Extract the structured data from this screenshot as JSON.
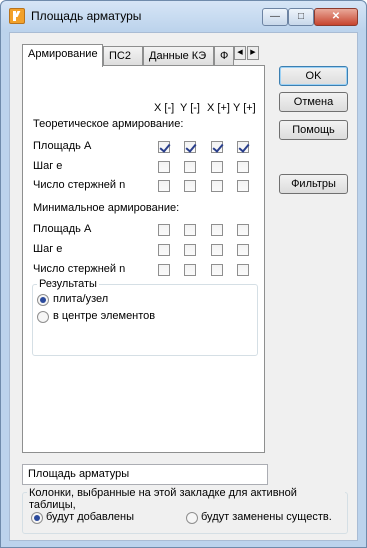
{
  "window": {
    "title": "Площадь арматуры"
  },
  "tabs": [
    "Армирование",
    "ПС2",
    "Данные КЭ",
    "Ф"
  ],
  "columns": [
    "X [-]",
    "Y [-]",
    "X [+]",
    "Y [+]"
  ],
  "theoretical": {
    "section_title": "Теоретическое армирование:",
    "rows": [
      {
        "label": "Площадь A",
        "checked": [
          true,
          true,
          true,
          true
        ]
      },
      {
        "label": "Шаг e",
        "checked": [
          false,
          false,
          false,
          false
        ]
      },
      {
        "label": "Число стержней n",
        "checked": [
          false,
          false,
          false,
          false
        ]
      }
    ]
  },
  "minimal": {
    "section_title": "Минимальное армирование:",
    "rows": [
      {
        "label": "Площадь A",
        "checked": [
          false,
          false,
          false,
          false
        ]
      },
      {
        "label": "Шаг e",
        "checked": [
          false,
          false,
          false,
          false
        ]
      },
      {
        "label": "Число стержней n",
        "checked": [
          false,
          false,
          false,
          false
        ]
      }
    ]
  },
  "results": {
    "title": "Результаты",
    "options": [
      "плита/узел",
      "в центре элементов"
    ],
    "selected": 0
  },
  "buttons": {
    "ok": "OK",
    "cancel": "Отмена",
    "help": "Помощь",
    "filters": "Фильтры"
  },
  "name_field": {
    "value": "Площадь арматуры"
  },
  "columns_group": {
    "title": "Колонки, выбранные на этой закладке для активной таблицы,",
    "options": [
      "будут добавлены",
      "будут заменены существ."
    ],
    "selected": 0
  }
}
